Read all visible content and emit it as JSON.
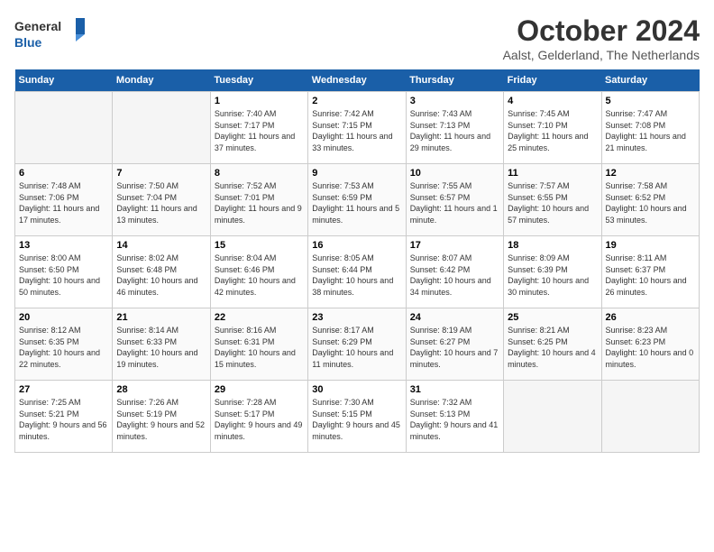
{
  "logo": {
    "line1": "General",
    "line2": "Blue"
  },
  "title": "October 2024",
  "subtitle": "Aalst, Gelderland, The Netherlands",
  "weekdays": [
    "Sunday",
    "Monday",
    "Tuesday",
    "Wednesday",
    "Thursday",
    "Friday",
    "Saturday"
  ],
  "weeks": [
    [
      null,
      null,
      {
        "day": 1,
        "sunrise": "Sunrise: 7:40 AM",
        "sunset": "Sunset: 7:17 PM",
        "daylight": "Daylight: 11 hours and 37 minutes."
      },
      {
        "day": 2,
        "sunrise": "Sunrise: 7:42 AM",
        "sunset": "Sunset: 7:15 PM",
        "daylight": "Daylight: 11 hours and 33 minutes."
      },
      {
        "day": 3,
        "sunrise": "Sunrise: 7:43 AM",
        "sunset": "Sunset: 7:13 PM",
        "daylight": "Daylight: 11 hours and 29 minutes."
      },
      {
        "day": 4,
        "sunrise": "Sunrise: 7:45 AM",
        "sunset": "Sunset: 7:10 PM",
        "daylight": "Daylight: 11 hours and 25 minutes."
      },
      {
        "day": 5,
        "sunrise": "Sunrise: 7:47 AM",
        "sunset": "Sunset: 7:08 PM",
        "daylight": "Daylight: 11 hours and 21 minutes."
      }
    ],
    [
      {
        "day": 6,
        "sunrise": "Sunrise: 7:48 AM",
        "sunset": "Sunset: 7:06 PM",
        "daylight": "Daylight: 11 hours and 17 minutes."
      },
      {
        "day": 7,
        "sunrise": "Sunrise: 7:50 AM",
        "sunset": "Sunset: 7:04 PM",
        "daylight": "Daylight: 11 hours and 13 minutes."
      },
      {
        "day": 8,
        "sunrise": "Sunrise: 7:52 AM",
        "sunset": "Sunset: 7:01 PM",
        "daylight": "Daylight: 11 hours and 9 minutes."
      },
      {
        "day": 9,
        "sunrise": "Sunrise: 7:53 AM",
        "sunset": "Sunset: 6:59 PM",
        "daylight": "Daylight: 11 hours and 5 minutes."
      },
      {
        "day": 10,
        "sunrise": "Sunrise: 7:55 AM",
        "sunset": "Sunset: 6:57 PM",
        "daylight": "Daylight: 11 hours and 1 minute."
      },
      {
        "day": 11,
        "sunrise": "Sunrise: 7:57 AM",
        "sunset": "Sunset: 6:55 PM",
        "daylight": "Daylight: 10 hours and 57 minutes."
      },
      {
        "day": 12,
        "sunrise": "Sunrise: 7:58 AM",
        "sunset": "Sunset: 6:52 PM",
        "daylight": "Daylight: 10 hours and 53 minutes."
      }
    ],
    [
      {
        "day": 13,
        "sunrise": "Sunrise: 8:00 AM",
        "sunset": "Sunset: 6:50 PM",
        "daylight": "Daylight: 10 hours and 50 minutes."
      },
      {
        "day": 14,
        "sunrise": "Sunrise: 8:02 AM",
        "sunset": "Sunset: 6:48 PM",
        "daylight": "Daylight: 10 hours and 46 minutes."
      },
      {
        "day": 15,
        "sunrise": "Sunrise: 8:04 AM",
        "sunset": "Sunset: 6:46 PM",
        "daylight": "Daylight: 10 hours and 42 minutes."
      },
      {
        "day": 16,
        "sunrise": "Sunrise: 8:05 AM",
        "sunset": "Sunset: 6:44 PM",
        "daylight": "Daylight: 10 hours and 38 minutes."
      },
      {
        "day": 17,
        "sunrise": "Sunrise: 8:07 AM",
        "sunset": "Sunset: 6:42 PM",
        "daylight": "Daylight: 10 hours and 34 minutes."
      },
      {
        "day": 18,
        "sunrise": "Sunrise: 8:09 AM",
        "sunset": "Sunset: 6:39 PM",
        "daylight": "Daylight: 10 hours and 30 minutes."
      },
      {
        "day": 19,
        "sunrise": "Sunrise: 8:11 AM",
        "sunset": "Sunset: 6:37 PM",
        "daylight": "Daylight: 10 hours and 26 minutes."
      }
    ],
    [
      {
        "day": 20,
        "sunrise": "Sunrise: 8:12 AM",
        "sunset": "Sunset: 6:35 PM",
        "daylight": "Daylight: 10 hours and 22 minutes."
      },
      {
        "day": 21,
        "sunrise": "Sunrise: 8:14 AM",
        "sunset": "Sunset: 6:33 PM",
        "daylight": "Daylight: 10 hours and 19 minutes."
      },
      {
        "day": 22,
        "sunrise": "Sunrise: 8:16 AM",
        "sunset": "Sunset: 6:31 PM",
        "daylight": "Daylight: 10 hours and 15 minutes."
      },
      {
        "day": 23,
        "sunrise": "Sunrise: 8:17 AM",
        "sunset": "Sunset: 6:29 PM",
        "daylight": "Daylight: 10 hours and 11 minutes."
      },
      {
        "day": 24,
        "sunrise": "Sunrise: 8:19 AM",
        "sunset": "Sunset: 6:27 PM",
        "daylight": "Daylight: 10 hours and 7 minutes."
      },
      {
        "day": 25,
        "sunrise": "Sunrise: 8:21 AM",
        "sunset": "Sunset: 6:25 PM",
        "daylight": "Daylight: 10 hours and 4 minutes."
      },
      {
        "day": 26,
        "sunrise": "Sunrise: 8:23 AM",
        "sunset": "Sunset: 6:23 PM",
        "daylight": "Daylight: 10 hours and 0 minutes."
      }
    ],
    [
      {
        "day": 27,
        "sunrise": "Sunrise: 7:25 AM",
        "sunset": "Sunset: 5:21 PM",
        "daylight": "Daylight: 9 hours and 56 minutes."
      },
      {
        "day": 28,
        "sunrise": "Sunrise: 7:26 AM",
        "sunset": "Sunset: 5:19 PM",
        "daylight": "Daylight: 9 hours and 52 minutes."
      },
      {
        "day": 29,
        "sunrise": "Sunrise: 7:28 AM",
        "sunset": "Sunset: 5:17 PM",
        "daylight": "Daylight: 9 hours and 49 minutes."
      },
      {
        "day": 30,
        "sunrise": "Sunrise: 7:30 AM",
        "sunset": "Sunset: 5:15 PM",
        "daylight": "Daylight: 9 hours and 45 minutes."
      },
      {
        "day": 31,
        "sunrise": "Sunrise: 7:32 AM",
        "sunset": "Sunset: 5:13 PM",
        "daylight": "Daylight: 9 hours and 41 minutes."
      },
      null,
      null
    ]
  ]
}
